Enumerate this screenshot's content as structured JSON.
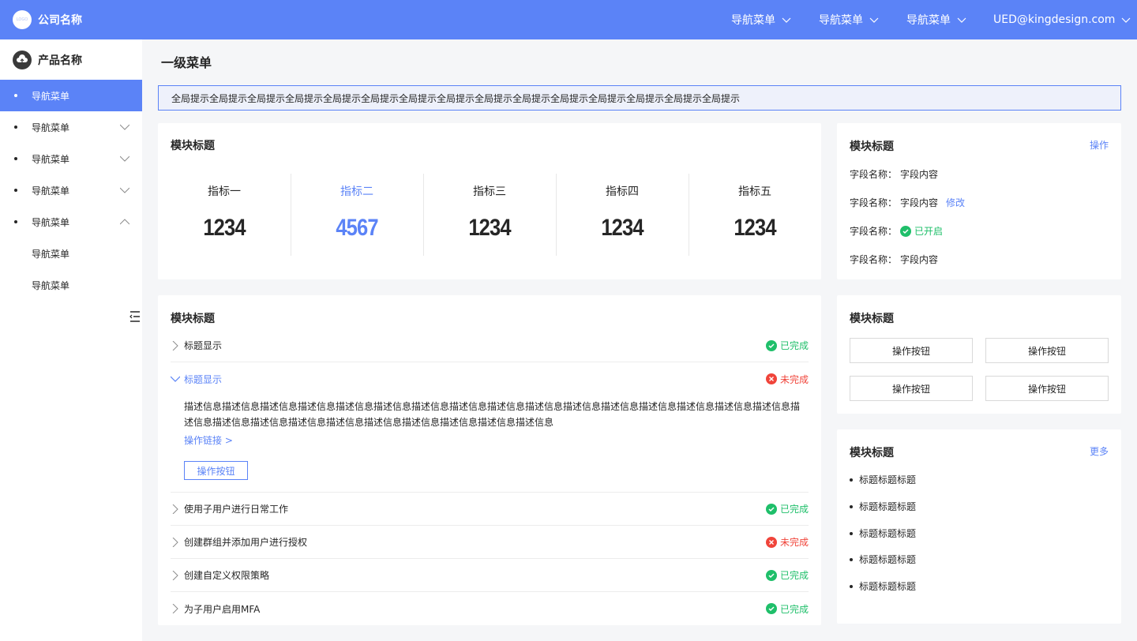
{
  "header": {
    "logo_text": "LOGO",
    "company": "公司名称",
    "nav": [
      "导航菜单",
      "导航菜单",
      "导航菜单"
    ],
    "user": "UED@kingdesign.com"
  },
  "sidebar": {
    "product": "产品名称",
    "items": [
      {
        "label": "导航菜单",
        "active": true
      },
      {
        "label": "导航菜单",
        "arrow": "down"
      },
      {
        "label": "导航菜单",
        "arrow": "down"
      },
      {
        "label": "导航菜单",
        "arrow": "down"
      },
      {
        "label": "导航菜单",
        "arrow": "up"
      },
      {
        "label": "导航菜单",
        "sub": true
      },
      {
        "label": "导航菜单",
        "sub": true
      }
    ]
  },
  "page": {
    "title": "一级菜单",
    "notice": "全局提示全局提示全局提示全局提示全局提示全局提示全局提示全局提示全局提示全局提示全局提示全局提示全局提示全局提示全局提示"
  },
  "metrics_card": {
    "title": "模块标题",
    "metrics": [
      {
        "label": "指标一",
        "value": "1234"
      },
      {
        "label": "指标二",
        "value": "4567",
        "highlight": true
      },
      {
        "label": "指标三",
        "value": "1234"
      },
      {
        "label": "指标四",
        "value": "1234"
      },
      {
        "label": "指标五",
        "value": "1234"
      }
    ]
  },
  "info_card": {
    "title": "模块标题",
    "action": "操作",
    "fields": [
      {
        "label": "字段名称：",
        "value": "字段内容"
      },
      {
        "label": "字段名称：",
        "value": "字段内容",
        "link": "修改"
      },
      {
        "label": "字段名称：",
        "status": "已开启"
      },
      {
        "label": "字段名称：",
        "value": "字段内容"
      }
    ]
  },
  "accordion_card": {
    "title": "模块标题",
    "rows": [
      {
        "title": "标题显示",
        "status": "已完成",
        "done": true
      },
      {
        "title": "标题显示",
        "status": "未完成",
        "done": false,
        "open": true
      },
      {
        "title": "使用子用户进行日常工作",
        "status": "已完成",
        "done": true
      },
      {
        "title": "创建群组并添加用户进行授权",
        "status": "未完成",
        "done": false
      },
      {
        "title": "创建自定义权限策略",
        "status": "已完成",
        "done": true
      },
      {
        "title": "为子用户启用MFA",
        "status": "已完成",
        "done": true
      }
    ],
    "desc": "描述信息描述信息描述信息描述信息描述信息描述信息描述信息描述信息描述信息描述信息描述信息描述信息描述信息描述信息描述信息描述信息描述信息描述信息描述信息描述信息描述信息描述信息描述信息描述信息描述信息描述信息",
    "link": "操作链接 >",
    "button": "操作按钮"
  },
  "buttons_card": {
    "title": "模块标题",
    "buttons": [
      "操作按钮",
      "操作按钮",
      "操作按钮",
      "操作按钮"
    ]
  },
  "list_card": {
    "title": "模块标题",
    "more": "更多",
    "items": [
      "标题标题标题",
      "标题标题标题",
      "标题标题标题",
      "标题标题标题",
      "标题标题标题"
    ]
  },
  "colors": {
    "primary": "#5b83f7",
    "success": "#1fbf6a",
    "danger": "#f0443a"
  }
}
